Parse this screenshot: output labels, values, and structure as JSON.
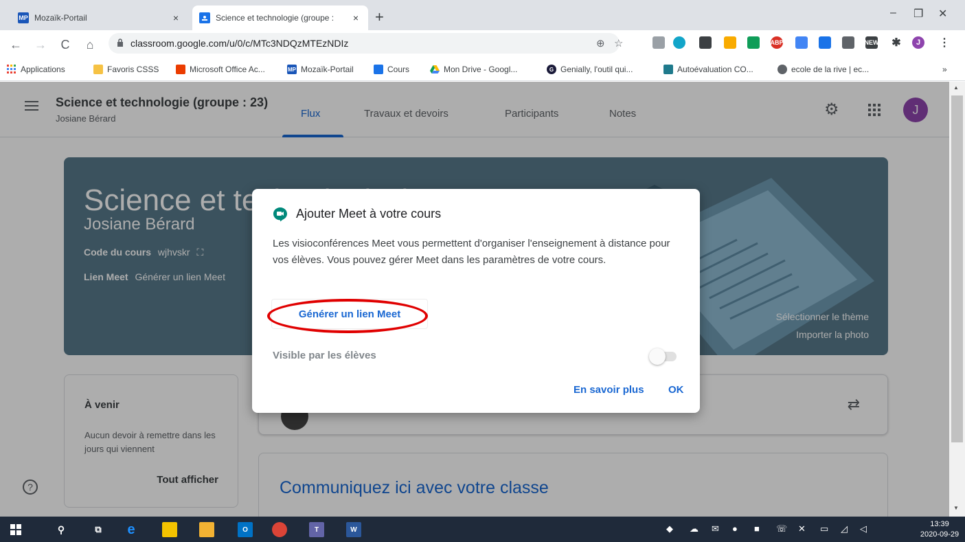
{
  "browser": {
    "tabs": [
      {
        "favicon": "MP",
        "title": "Mozaïk-Portail",
        "close": "×"
      },
      {
        "favicon": "classroom-icon",
        "title": "Science et technologie (groupe :",
        "close": "×"
      }
    ],
    "new_tab": "+",
    "window_controls": {
      "minimize": "–",
      "restore": "❐",
      "close": "✕"
    },
    "nav": {
      "back": "←",
      "forward": "→",
      "reload": "C",
      "home": "⌂"
    },
    "url": "classroom.google.com/u/0/c/MTc3NDQzMTEzNDIz",
    "bookmarks": [
      {
        "icon": "apps-grid-icon",
        "label": "Applications"
      },
      {
        "icon": "folder-icon",
        "label": "Favoris CSSS"
      },
      {
        "icon": "office-icon",
        "label": "Microsoft Office Ac..."
      },
      {
        "icon": "MP",
        "label": "Mozaïk-Portail"
      },
      {
        "icon": "classroom-icon",
        "label": "Cours"
      },
      {
        "icon": "drive-icon",
        "label": "Mon Drive - Googl..."
      },
      {
        "icon": "genially-icon",
        "label": "Genially, l'outil qui..."
      },
      {
        "icon": "autoeval-icon",
        "label": "Autoévaluation CO..."
      },
      {
        "icon": "globe-icon",
        "label": "ecole de la rive | ec..."
      }
    ],
    "bookmarks_more": "»",
    "profile_initial": "J"
  },
  "classroom": {
    "course_title": "Science et technologie (groupe : 23)",
    "teacher": "Josiane Bérard",
    "tabs": [
      "Flux",
      "Travaux et devoirs",
      "Participants",
      "Notes"
    ],
    "avatar_initial": "J",
    "banner": {
      "big_title": "Science et technologie (",
      "teacher": "Josiane Bérard",
      "code_label": "Code du cours",
      "code_value": "wjhvskr",
      "meet_label": "Lien Meet",
      "meet_value": "Générer un lien Meet",
      "select_theme": "Sélectionner le thème",
      "upload_photo": "Importer la photo"
    },
    "upcoming": {
      "heading": "À venir",
      "text": "Aucun devoir à remettre dans les jours qui viennent",
      "see_all": "Tout afficher"
    },
    "communicate": "Communiquez ici avec votre classe",
    "help": "?"
  },
  "dialog": {
    "title": "Ajouter Meet à votre cours",
    "body": "Les visioconférences Meet vous permettent d'organiser l'enseignement à distance pour vos élèves. Vous pouvez gérer Meet dans les paramètres de votre cours.",
    "generate_link": "Générer un lien Meet",
    "visible_label": "Visible par les élèves",
    "visible_on": false,
    "learn_more": "En savoir plus",
    "ok": "OK"
  },
  "taskbar": {
    "time": "13:39",
    "date": "2020-09-29"
  },
  "colors": {
    "accent": "#1967d2",
    "banner": "#587a8b",
    "annotation": "#e00000"
  }
}
